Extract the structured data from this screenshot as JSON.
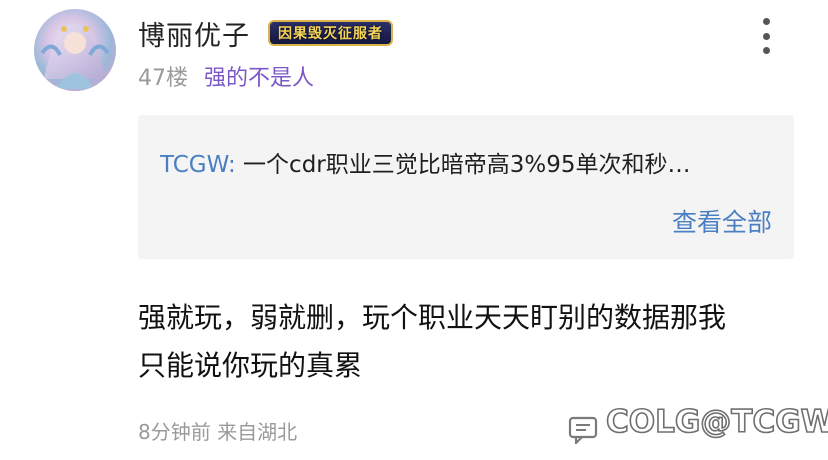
{
  "post": {
    "username": "博丽优子",
    "badge": "因果毁灭征服者",
    "floor": "47楼",
    "level_title": "强的不是人",
    "quote": {
      "user": "TCGW:",
      "text": " 一个cdr职业三觉比暗帝高3%95单次和秒…",
      "view_all": "查看全部"
    },
    "body_lines": [
      "强就玩，弱就删，玩个职业天天盯别的数据那我",
      "只能说你玩的真累"
    ],
    "time": "8分钟前",
    "location": "来自湖北",
    "watermark": "COLG@TCGW"
  },
  "colors": {
    "accent_blue": "#4a7fc1",
    "level_purple": "#7b58c6",
    "meta_gray": "#9a9a9a"
  },
  "icons": {
    "more": "more-vertical-icon",
    "reply": "comment-icon"
  }
}
